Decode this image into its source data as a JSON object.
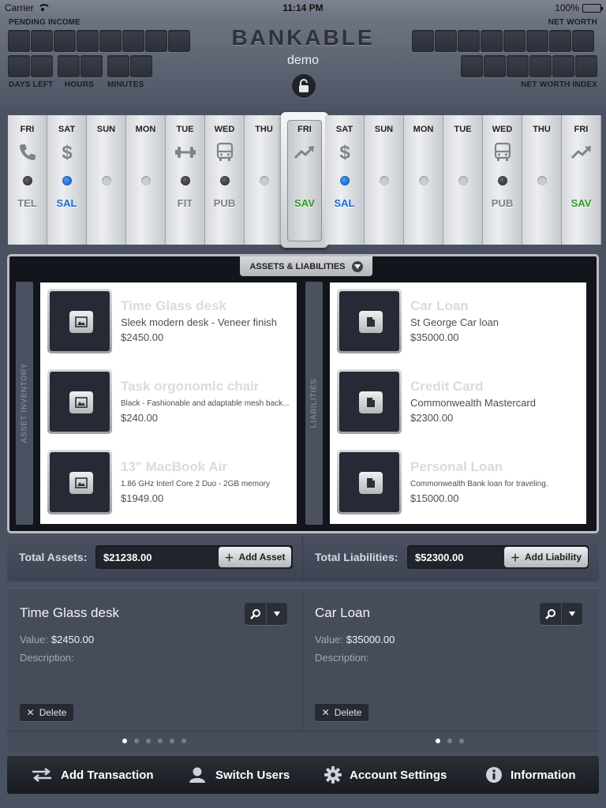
{
  "status_bar": {
    "carrier": "Carrier",
    "time": "11:14 PM",
    "battery": "100%"
  },
  "header": {
    "brand": "BANKABLE",
    "subtitle": "demo",
    "pending_income_label": "PENDING INCOME",
    "net_worth_label": "NET WORTH",
    "days_left_label": "DAYS LEFT",
    "hours_label": "HOURS",
    "minutes_label": "MINUTES",
    "net_worth_index_label": "NET WORTH INDEX"
  },
  "calendar": {
    "days": [
      {
        "name": "FRI",
        "icon": "phone-icon",
        "dot": "dark",
        "code": "TEL",
        "code_color": "gray"
      },
      {
        "name": "SAT",
        "icon": "dollar-icon",
        "dot": "blue",
        "code": "SAL",
        "code_color": "blue"
      },
      {
        "name": "SUN",
        "icon": "",
        "dot": "light",
        "code": "",
        "code_color": "gray"
      },
      {
        "name": "MON",
        "icon": "",
        "dot": "light",
        "code": "",
        "code_color": "gray"
      },
      {
        "name": "TUE",
        "icon": "dumbbell-icon",
        "dot": "dark",
        "code": "FIT",
        "code_color": "gray"
      },
      {
        "name": "WED",
        "icon": "bus-icon",
        "dot": "dark",
        "code": "PUB",
        "code_color": "gray"
      },
      {
        "name": "THU",
        "icon": "",
        "dot": "light",
        "code": "",
        "code_color": "gray"
      },
      {
        "name": "FRI",
        "icon": "trend-up-icon",
        "dot": "none",
        "code": "SAV",
        "code_color": "green",
        "selected": true
      },
      {
        "name": "SAT",
        "icon": "dollar-icon",
        "dot": "blue",
        "code": "SAL",
        "code_color": "blue"
      },
      {
        "name": "SUN",
        "icon": "",
        "dot": "light",
        "code": "",
        "code_color": "gray"
      },
      {
        "name": "MON",
        "icon": "",
        "dot": "light",
        "code": "",
        "code_color": "gray"
      },
      {
        "name": "TUE",
        "icon": "",
        "dot": "light",
        "code": "",
        "code_color": "gray"
      },
      {
        "name": "WED",
        "icon": "bus-icon",
        "dot": "dark",
        "code": "PUB",
        "code_color": "gray"
      },
      {
        "name": "THU",
        "icon": "",
        "dot": "light",
        "code": "",
        "code_color": "gray"
      },
      {
        "name": "FRI",
        "icon": "trend-up-icon",
        "dot": "none",
        "code": "SAV",
        "code_color": "green"
      }
    ]
  },
  "panel": {
    "tab_label": "ASSETS & LIABILITIES",
    "assets_side_label": "ASSET INVENTORY",
    "liabilities_side_label": "LIABILITIES",
    "assets": [
      {
        "title": "Time Glass desk",
        "desc": "Sleek modern desk - Veneer finish",
        "price": "$2450.00"
      },
      {
        "title": "Task orgonomic chair",
        "desc": "Black - Fashionable and adaptable mesh back...",
        "price": "$240.00"
      },
      {
        "title": "13\" MacBook Air",
        "desc": "1.86 GHz Interl Core 2 Duo - 2GB memory",
        "price": "$1949.00"
      }
    ],
    "liabilities": [
      {
        "title": "Car Loan",
        "desc": "St George Car loan",
        "price": "$35000.00"
      },
      {
        "title": "Credit Card",
        "desc": "Commonwealth Mastercard",
        "price": "$2300.00"
      },
      {
        "title": "Personal Loan",
        "desc": "Commonwealth Bank loan for traveling.",
        "price": "$15000.00"
      }
    ]
  },
  "totals": {
    "assets_label": "Total Assets:",
    "assets_value": "$21238.00",
    "add_asset": "Add Asset",
    "liabilities_label": "Total Liabilities:",
    "liabilities_value": "$52300.00",
    "add_liability": "Add Liability"
  },
  "details": {
    "asset": {
      "title": "Time Glass desk",
      "value_label": "Value:",
      "value": "$2450.00",
      "desc_label": "Description:",
      "delete": "Delete",
      "pages": 6,
      "current_page": 1
    },
    "liability": {
      "title": "Car Loan",
      "value_label": "Value:",
      "value": "$35000.00",
      "desc_label": "Description:",
      "delete": "Delete",
      "pages": 3,
      "current_page": 1
    }
  },
  "toolbar": {
    "add_transaction": "Add Transaction",
    "switch_users": "Switch Users",
    "account_settings": "Account Settings",
    "information": "Information"
  },
  "colors": {
    "blue_code": "#1f6ad6",
    "green_code": "#2f9a2b",
    "background": "#4a5262"
  }
}
